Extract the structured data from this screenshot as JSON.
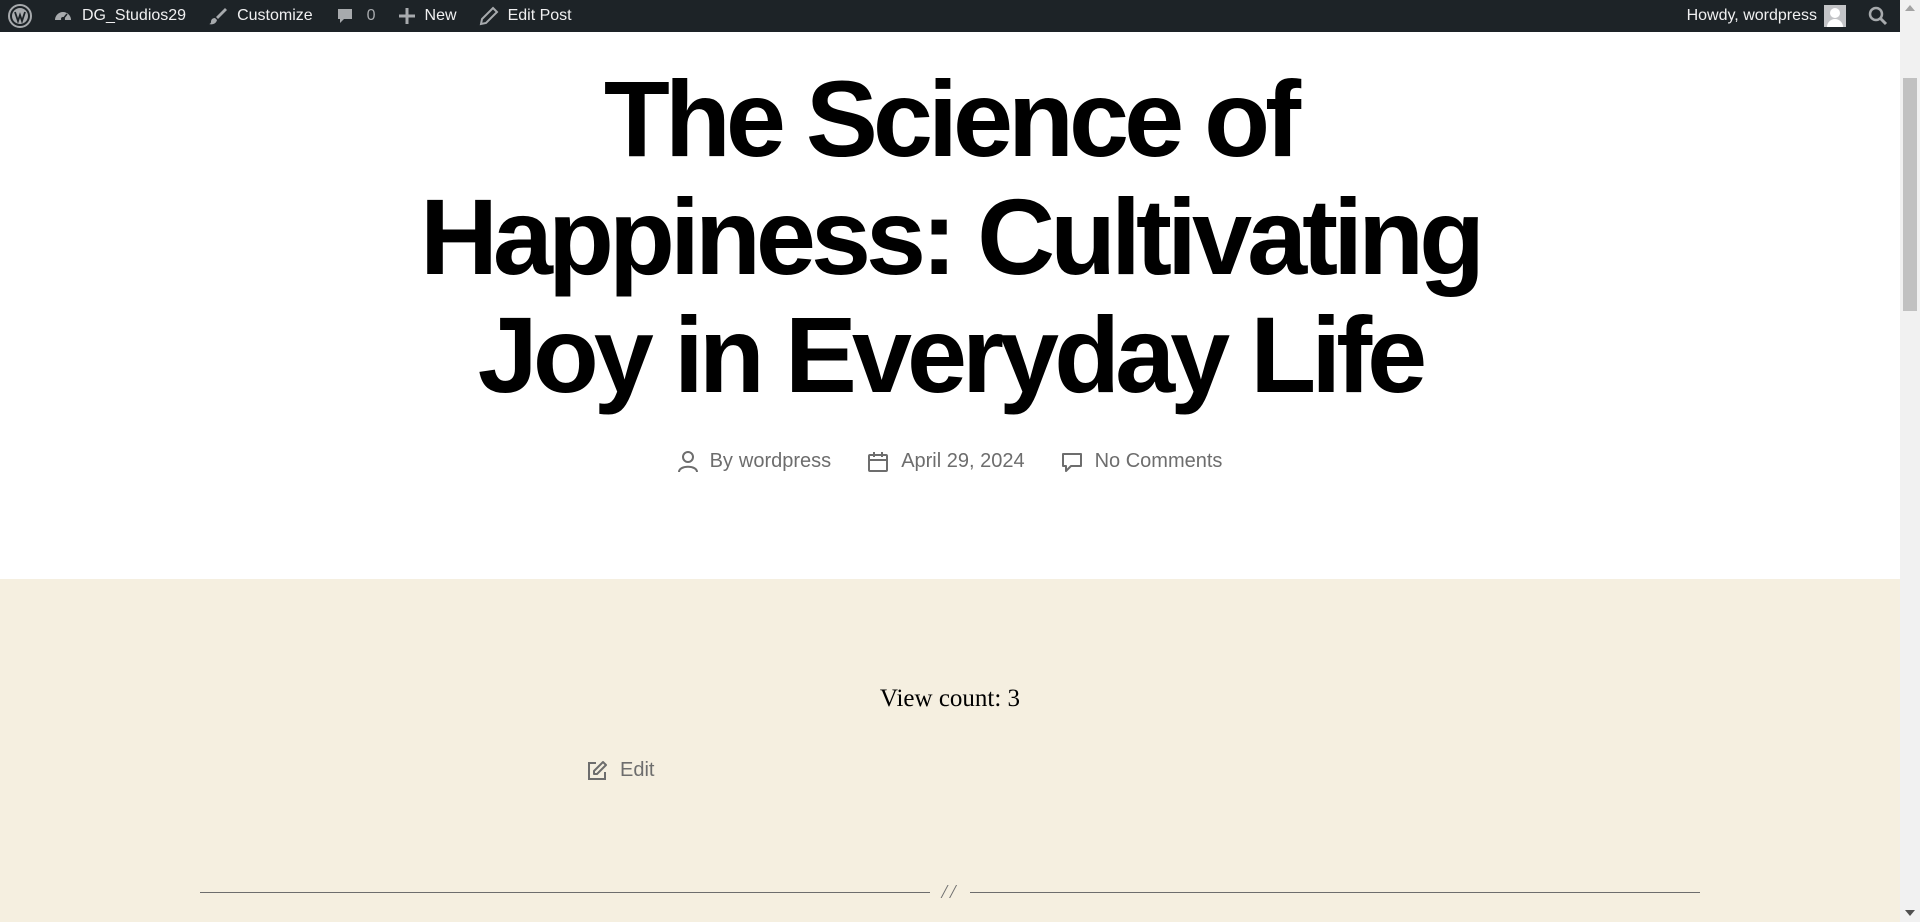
{
  "admin_bar": {
    "wp_logo_icon": "wordpress-logo-icon",
    "site_name": "DG_Studios29",
    "customize_label": "Customize",
    "comments_count": "0",
    "new_label": "New",
    "edit_post_label": "Edit Post",
    "howdy_label": "Howdy, wordpress",
    "colors": {
      "background": "#1d2327",
      "text": "#f0f0f1"
    }
  },
  "post": {
    "title": "The Science of Happiness: Cultivating Joy in Everyday Life",
    "meta": {
      "author_prefix": "By",
      "author": "wordpress",
      "date": "April 29, 2024",
      "comments": "No Comments"
    },
    "view_count_text": "View count: 3",
    "edit_label": "Edit",
    "separator_text": "//"
  },
  "colors": {
    "content_background": "#f5efe0",
    "meta_text": "#6d6d6d",
    "title_text": "#000000"
  },
  "icons": {
    "author": "user-icon",
    "date": "calendar-icon",
    "comments": "comment-bubble-icon",
    "edit": "edit-icon",
    "search": "search-icon",
    "customize": "paintbrush-icon",
    "new": "plus-icon",
    "edit_post": "pencil-icon",
    "site": "dashboard-gauge-icon"
  }
}
